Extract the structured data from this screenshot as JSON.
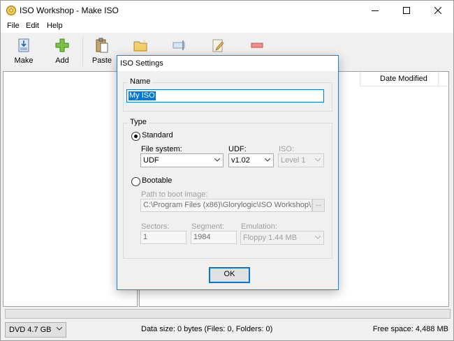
{
  "window": {
    "title": "ISO Workshop - Make ISO"
  },
  "menu": {
    "items": [
      "File",
      "Edit",
      "Help"
    ]
  },
  "toolbar": {
    "make_label": "Make",
    "add_label": "Add",
    "paste_label": "Paste"
  },
  "list": {
    "date_modified_header": "Date Modified"
  },
  "status": {
    "disc_type": "DVD 4.7 GB",
    "data_size": "Data size: 0 bytes (Files: 0, Folders: 0)",
    "free_space": "Free space: 4,488 MB"
  },
  "dialog": {
    "title": "ISO Settings",
    "name_group": "Name",
    "name_value": "My ISO",
    "type_group": "Type",
    "standard_label": "Standard",
    "file_system_label": "File system:",
    "file_system_value": "UDF",
    "udf_label": "UDF:",
    "udf_value": "v1.02",
    "iso_label": "ISO:",
    "iso_value": "Level 1",
    "bootable_label": "Bootable",
    "boot_image_label": "Path to boot image:",
    "boot_image_value": "C:\\Program Files (x86)\\Glorylogic\\ISO Workshop\\Do",
    "browse_label": "...",
    "sectors_label": "Sectors:",
    "sectors_value": "1",
    "segment_label": "Segment:",
    "segment_value": "1984",
    "emulation_label": "Emulation:",
    "emulation_value": "Floppy 1.44 MB",
    "ok_label": "OK"
  },
  "colors": {
    "accent": "#0078d7",
    "dialog_border": "#1883d7"
  }
}
